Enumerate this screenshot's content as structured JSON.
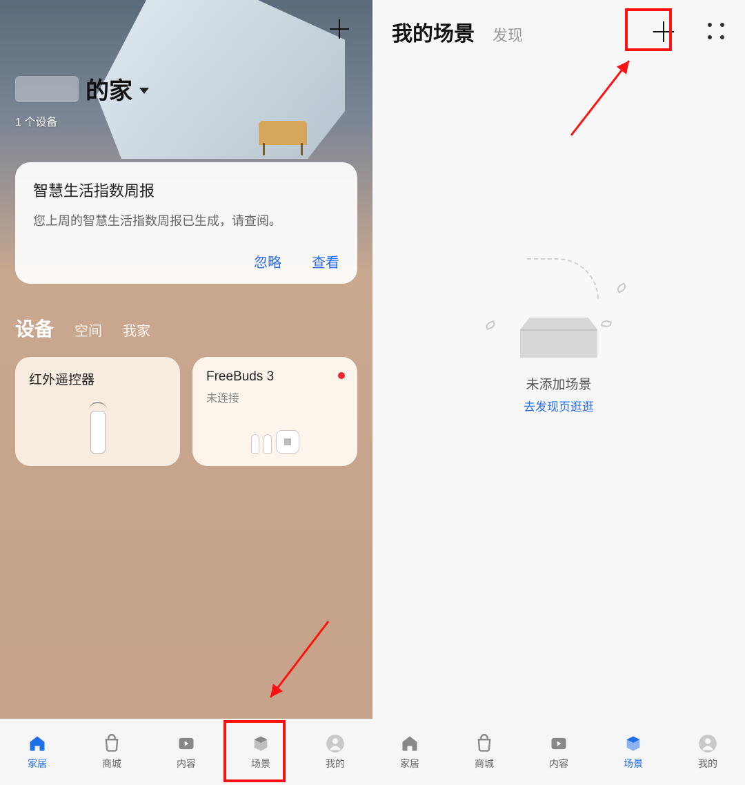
{
  "left": {
    "home_title_suffix": "的家",
    "device_count": "1 个设备",
    "report": {
      "title": "智慧生活指数周报",
      "description": "您上周的智慧生活指数周报已生成，请查阅。",
      "ignore": "忽略",
      "view": "查看"
    },
    "section_tabs": {
      "devices": "设备",
      "space": "空间",
      "my_home": "我家"
    },
    "devices": [
      {
        "name": "红外遥控器",
        "sub": "",
        "status": ""
      },
      {
        "name": "FreeBuds 3",
        "sub": "未连接",
        "status": "red"
      }
    ],
    "nav": [
      "家居",
      "商城",
      "内容",
      "场景",
      "我的"
    ],
    "nav_active": 0
  },
  "right": {
    "tabs": {
      "my_scenes": "我的场景",
      "discover": "发现"
    },
    "empty_title": "未添加场景",
    "empty_link": "去发现页逛逛",
    "nav": [
      "家居",
      "商城",
      "内容",
      "场景",
      "我的"
    ],
    "nav_active": 3
  },
  "icons": {
    "plus": "plus-icon",
    "chevron_down": "chevron-down-icon",
    "home": "home-icon",
    "shop": "shop-icon",
    "content": "play-icon",
    "scene": "cube-icon",
    "profile": "person-icon",
    "grid": "grid-icon"
  }
}
